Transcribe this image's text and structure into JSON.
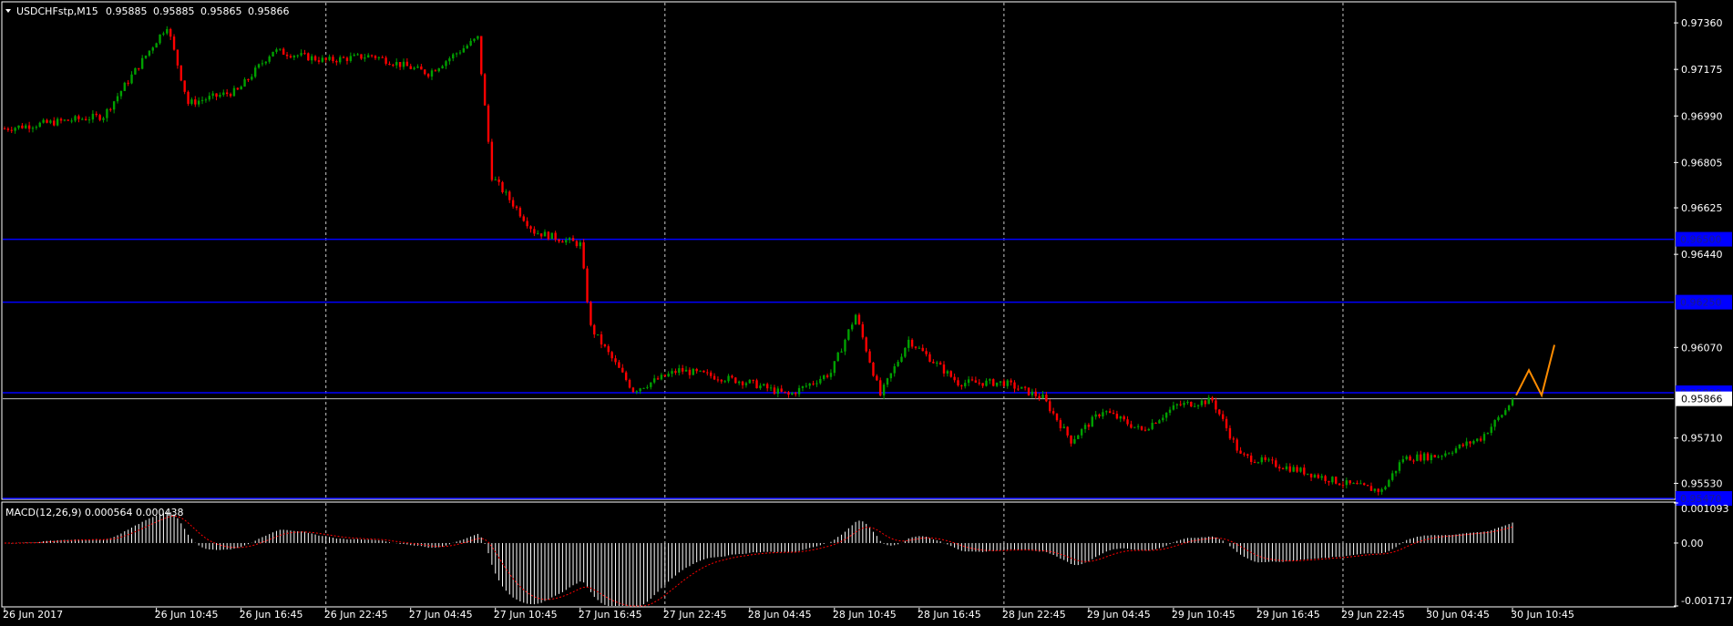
{
  "main": {
    "symbol_title": "USDCHFstp,M15",
    "ohlc": [
      "0.95885",
      "0.95885",
      "0.95865",
      "0.95866"
    ],
    "price_ticks": [
      "0.97360",
      "0.97175",
      "0.96990",
      "0.96805",
      "0.96625",
      "0.96440",
      "0.96070",
      "0.95710",
      "0.95530"
    ],
    "current_price_label": "0.95866",
    "hlines": [
      {
        "price": 0.965,
        "label": "0.96500"
      },
      {
        "price": 0.9625,
        "label": "0.96250"
      },
      {
        "price": 0.9589,
        "label": "0.95890"
      },
      {
        "price": 0.9547,
        "label": "0.95470"
      }
    ]
  },
  "macd": {
    "title": "MACD(12,26,9) 0.000564 0.000438",
    "ticks": [
      "0.001093",
      "0.00",
      "-0.001717"
    ]
  },
  "time_labels": [
    "26 Jun 2017",
    "26 Jun 10:45",
    "26 Jun 16:45",
    "26 Jun 22:45",
    "27 Jun 04:45",
    "27 Jun 10:45",
    "27 Jun 16:45",
    "27 Jun 22:45",
    "28 Jun 04:45",
    "28 Jun 10:45",
    "28 Jun 16:45",
    "28 Jun 22:45",
    "29 Jun 04:45",
    "29 Jun 10:45",
    "29 Jun 16:45",
    "29 Jun 22:45",
    "30 Jun 04:45",
    "30 Jun 10:45"
  ],
  "colors": {
    "background": "#000000",
    "bull": "#00a000",
    "bear": "#ff0000",
    "grid_dash": "#c8c8c8",
    "hline": "#0000ff",
    "projection": "#ff8c00",
    "signal": "#ff0000",
    "histogram": "#ffffff"
  },
  "chart_data": {
    "type": "candlestick",
    "title": "USDCHFstp,M15",
    "timeframe": "M15",
    "ylim": [
      0.9547,
      0.9744
    ],
    "price_path": [
      [
        "26 Jun 2017",
        0.9694
      ],
      [
        "26 Jun 07:00",
        0.9699
      ],
      [
        "26 Jun 10:00",
        0.9723
      ],
      [
        "26 Jun 11:30",
        0.9735
      ],
      [
        "26 Jun 13:00",
        0.9704
      ],
      [
        "26 Jun 16:30",
        0.9709
      ],
      [
        "26 Jun 19:00",
        0.9725
      ],
      [
        "26 Jun 22:45",
        0.9721
      ],
      [
        "27 Jun 02:00",
        0.9723
      ],
      [
        "27 Jun 06:00",
        0.9716
      ],
      [
        "27 Jun 09:30",
        0.973
      ],
      [
        "27 Jun 10:30",
        0.9675
      ],
      [
        "27 Jun 13:30",
        0.9653
      ],
      [
        "27 Jun 16:45",
        0.9648
      ],
      [
        "27 Jun 17:30",
        0.9615
      ],
      [
        "27 Jun 20:30",
        0.959
      ],
      [
        "27 Jun 23:45",
        0.9598
      ],
      [
        "28 Jun 04:45",
        0.9593
      ],
      [
        "28 Jun 07:30",
        0.9588
      ],
      [
        "28 Jun 10:30",
        0.9597
      ],
      [
        "28 Jun 12:15",
        0.962
      ],
      [
        "28 Jun 14:00",
        0.9588
      ],
      [
        "28 Jun 16:00",
        0.961
      ],
      [
        "28 Jun 19:30",
        0.9593
      ],
      [
        "28 Jun 22:45",
        0.9593
      ],
      [
        "29 Jun 01:30",
        0.9587
      ],
      [
        "29 Jun 03:30",
        0.957
      ],
      [
        "29 Jun 05:45",
        0.9582
      ],
      [
        "29 Jun 08:30",
        0.9574
      ],
      [
        "29 Jun 11:00",
        0.9584
      ],
      [
        "29 Jun 13:30",
        0.9586
      ],
      [
        "29 Jun 15:30",
        0.9564
      ],
      [
        "29 Jun 19:45",
        0.9558
      ],
      [
        "29 Jun 22:45",
        0.9553
      ],
      [
        "30 Jun 01:30",
        0.955
      ],
      [
        "30 Jun 03:00",
        0.9563
      ],
      [
        "30 Jun 05:30",
        0.9564
      ],
      [
        "30 Jun 08:30",
        0.9571
      ],
      [
        "30 Jun 10:15",
        0.9582
      ],
      [
        "30 Jun 10:45",
        0.95866
      ]
    ],
    "current_price": 0.95866,
    "levels": [
      0.965,
      0.9625,
      0.9589,
      0.9547
    ],
    "projection_path": [
      0.9588,
      0.9598,
      0.9588,
      0.9608
    ],
    "macd_params": "12,26,9",
    "macd_value": 0.000564,
    "macd_signal": 0.000438,
    "macd_ylim": [
      -0.001717,
      0.001093
    ]
  }
}
